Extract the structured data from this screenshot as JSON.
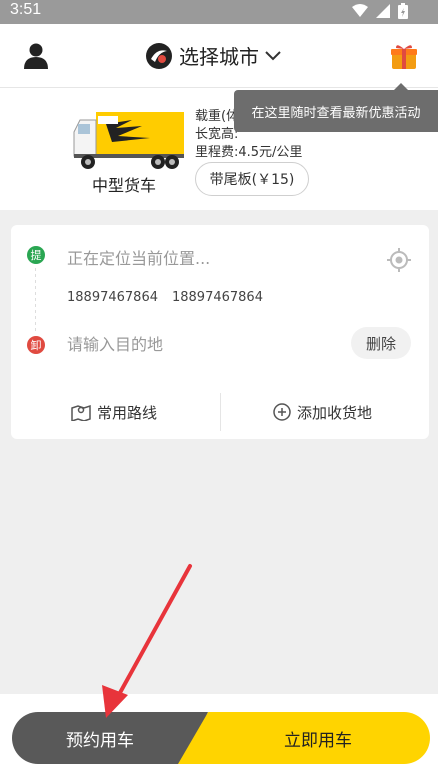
{
  "status_bar": {
    "time": "3:51"
  },
  "header": {
    "city_label": "选择城市",
    "tooltip": "在这里随时查看最新优惠活动"
  },
  "truck": {
    "name": "中型货车",
    "spec_weight": "载重(体",
    "spec_size": "长宽高:",
    "spec_price": "里程费:4.5元/公里",
    "tail_board": "带尾板(￥15)"
  },
  "route": {
    "pickup_dot": "提",
    "drop_dot": "卸",
    "locating": "正在定位当前位置...",
    "phone_1": "18897467864",
    "phone_2": "18897467864",
    "dest_placeholder": "请输入目的地",
    "delete_label": "删除",
    "common_routes": "常用路线",
    "add_address": "添加收货地"
  },
  "actions": {
    "reserve_label": "预约用车",
    "now_label": "立即用车"
  },
  "colors": {
    "accent_yellow": "#ffd400",
    "pickup_green": "#2aa652",
    "drop_red": "#e04a40",
    "arrow_red": "#e8343b"
  }
}
